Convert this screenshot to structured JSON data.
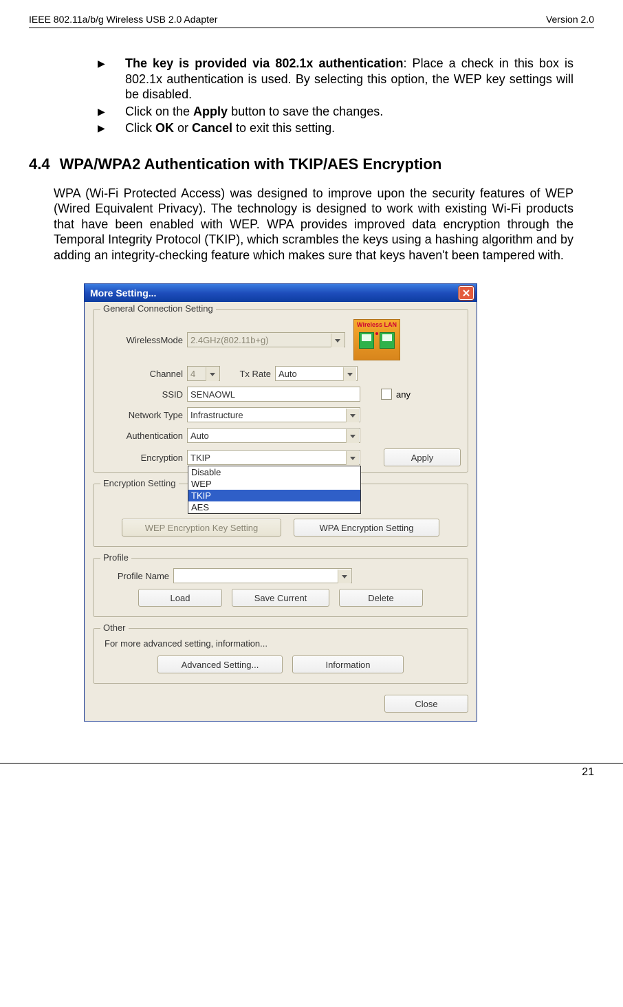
{
  "header": {
    "left": "IEEE 802.11a/b/g Wireless USB 2.0 Adapter",
    "right": "Version 2.0"
  },
  "bullets": {
    "b1_strong": "The key is provided via 802.1x authentication",
    "b1_rest": ": Place a check in this box is 802.1x authentication is used. By selecting this option, the WEP key settings will be disabled.",
    "b2_pre": "Click on the ",
    "b2_strong": "Apply",
    "b2_post": " button to save the changes.",
    "b3_pre": "Click ",
    "b3_s1": "OK",
    "b3_mid": " or ",
    "b3_s2": "Cancel",
    "b3_post": " to exit this setting."
  },
  "section": {
    "num": "4.4",
    "title": "WPA/WPA2 Authentication with TKIP/AES Encryption"
  },
  "paragraph": "WPA (Wi-Fi Protected Access) was designed to improve upon the security features of WEP (Wired Equivalent Privacy).  The technology is designed to work with existing Wi-Fi products that have been enabled with WEP.  WPA provides improved data encryption through the Temporal Integrity Protocol (TKIP), which scrambles the keys using a hashing algorithm and by adding an integrity-checking feature which makes sure that keys haven't been tampered with.",
  "dialog": {
    "title": "More Setting...",
    "group_general": "General Connection Setting",
    "labels": {
      "wirelessMode": "WirelessMode",
      "channel": "Channel",
      "txRate": "Tx Rate",
      "ssid": "SSID",
      "networkType": "Network Type",
      "authentication": "Authentication",
      "encryption": "Encryption"
    },
    "values": {
      "wirelessMode": "2.4GHz(802.11b+g)",
      "channel": "4",
      "txRate": "Auto",
      "ssid": "SENAOWL",
      "networkType": "Infrastructure",
      "authentication": "Auto",
      "encryption": "TKIP"
    },
    "wlan_text": "Wireless LAN",
    "any_label": "any",
    "apply": "Apply",
    "enc_options": [
      "Disable",
      "WEP",
      "TKIP",
      "AES"
    ],
    "enc_selected_index": 2,
    "group_enc": "Encryption Setting",
    "btn_wep": "WEP Encryption Key Setting",
    "btn_wpa": "WPA Encryption Setting",
    "group_profile": "Profile",
    "profile_name_label": "Profile Name",
    "btn_load": "Load",
    "btn_save": "Save Current",
    "btn_delete": "Delete",
    "group_other": "Other",
    "other_text": "For more advanced setting, information...",
    "btn_adv": "Advanced Setting...",
    "btn_info": "Information",
    "btn_close": "Close"
  },
  "page_number": "21"
}
